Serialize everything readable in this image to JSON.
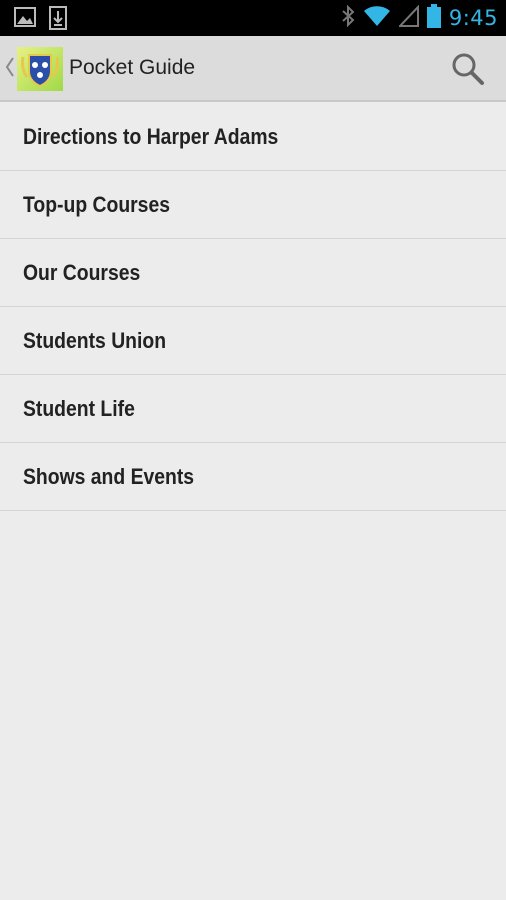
{
  "status_bar": {
    "time": "9:45",
    "icons": [
      "image-notification-icon",
      "download-notification-icon",
      "bluetooth-icon",
      "wifi-icon",
      "cell-signal-icon",
      "battery-icon"
    ]
  },
  "action_bar": {
    "title": "Pocket Guide",
    "icons": [
      "up-caret-icon",
      "app-logo-icon",
      "search-icon"
    ]
  },
  "menu": {
    "items": [
      {
        "label": "Directions to Harper Adams"
      },
      {
        "label": "Top-up Courses"
      },
      {
        "label": "Our Courses"
      },
      {
        "label": "Students Union"
      },
      {
        "label": "Student Life"
      },
      {
        "label": "Shows and Events"
      }
    ]
  },
  "colors": {
    "status_accent": "#33b5e5",
    "background": "#ececec",
    "action_bar": "#dcdcdc"
  }
}
